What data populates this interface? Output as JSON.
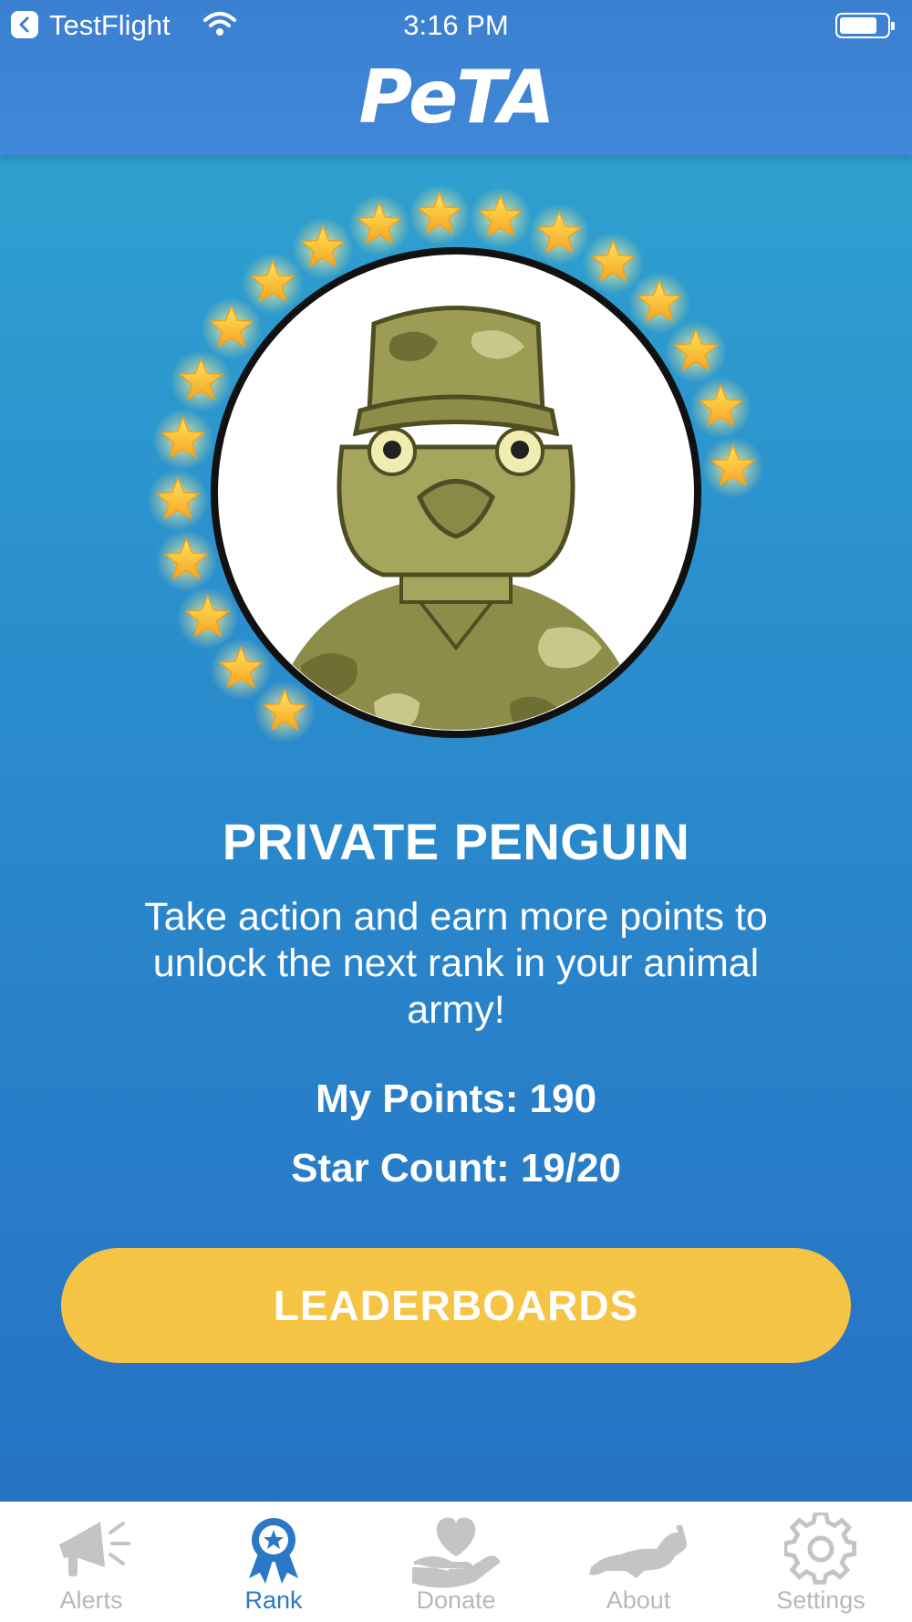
{
  "status_bar": {
    "back_label": "TestFlight",
    "time": "3:16 PM"
  },
  "header": {
    "logo_text": "PeTA"
  },
  "rank": {
    "title": "PRIVATE PENGUIN",
    "description": "Take action and earn more points to unlock the next rank in your animal army!",
    "points_text": "My Points: 190",
    "star_count_text": "Star Count: 19/20",
    "stars_earned": 19,
    "stars_total": 20
  },
  "leaderboards_button": {
    "label": "LEADERBOARDS"
  },
  "tabs": [
    {
      "label": "Alerts",
      "icon": "megaphone-icon",
      "active": false
    },
    {
      "label": "Rank",
      "icon": "ribbon-award-icon",
      "active": true
    },
    {
      "label": "Donate",
      "icon": "heart-hand-icon",
      "active": false
    },
    {
      "label": "About",
      "icon": "rabbit-icon",
      "active": false
    },
    {
      "label": "Settings",
      "icon": "gear-icon",
      "active": false
    }
  ],
  "colors": {
    "accent": "#2a78c6",
    "button": "#f6c444",
    "tab_inactive": "#b8b8b8"
  }
}
